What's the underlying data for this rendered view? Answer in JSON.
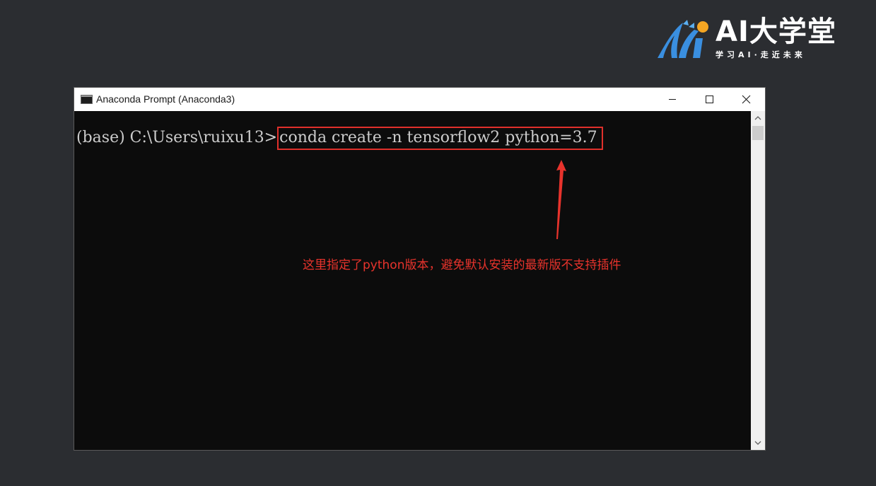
{
  "brand": {
    "title": "AI大学堂",
    "subtitle": "学习AI·走近未来",
    "colors": {
      "blue": "#3a8fe0",
      "orange": "#f5a623"
    }
  },
  "window": {
    "title": "Anaconda Prompt (Anaconda3)",
    "icon": "console-icon",
    "controls": [
      "minimize-icon",
      "maximize-icon",
      "close-icon"
    ]
  },
  "console": {
    "prompt": "(base) C:\\Users\\ruixu13>",
    "command": "conda create -n tensorflow2 python=3.7"
  },
  "annotation": {
    "text": "这里指定了python版本，避免默认安装的最新版不支持插件",
    "color": "#e8332c"
  },
  "colors": {
    "page_background": "#2b2d31",
    "console_background": "#0c0c0c",
    "console_text": "#cccccc",
    "highlight_box": "#e0302b"
  }
}
